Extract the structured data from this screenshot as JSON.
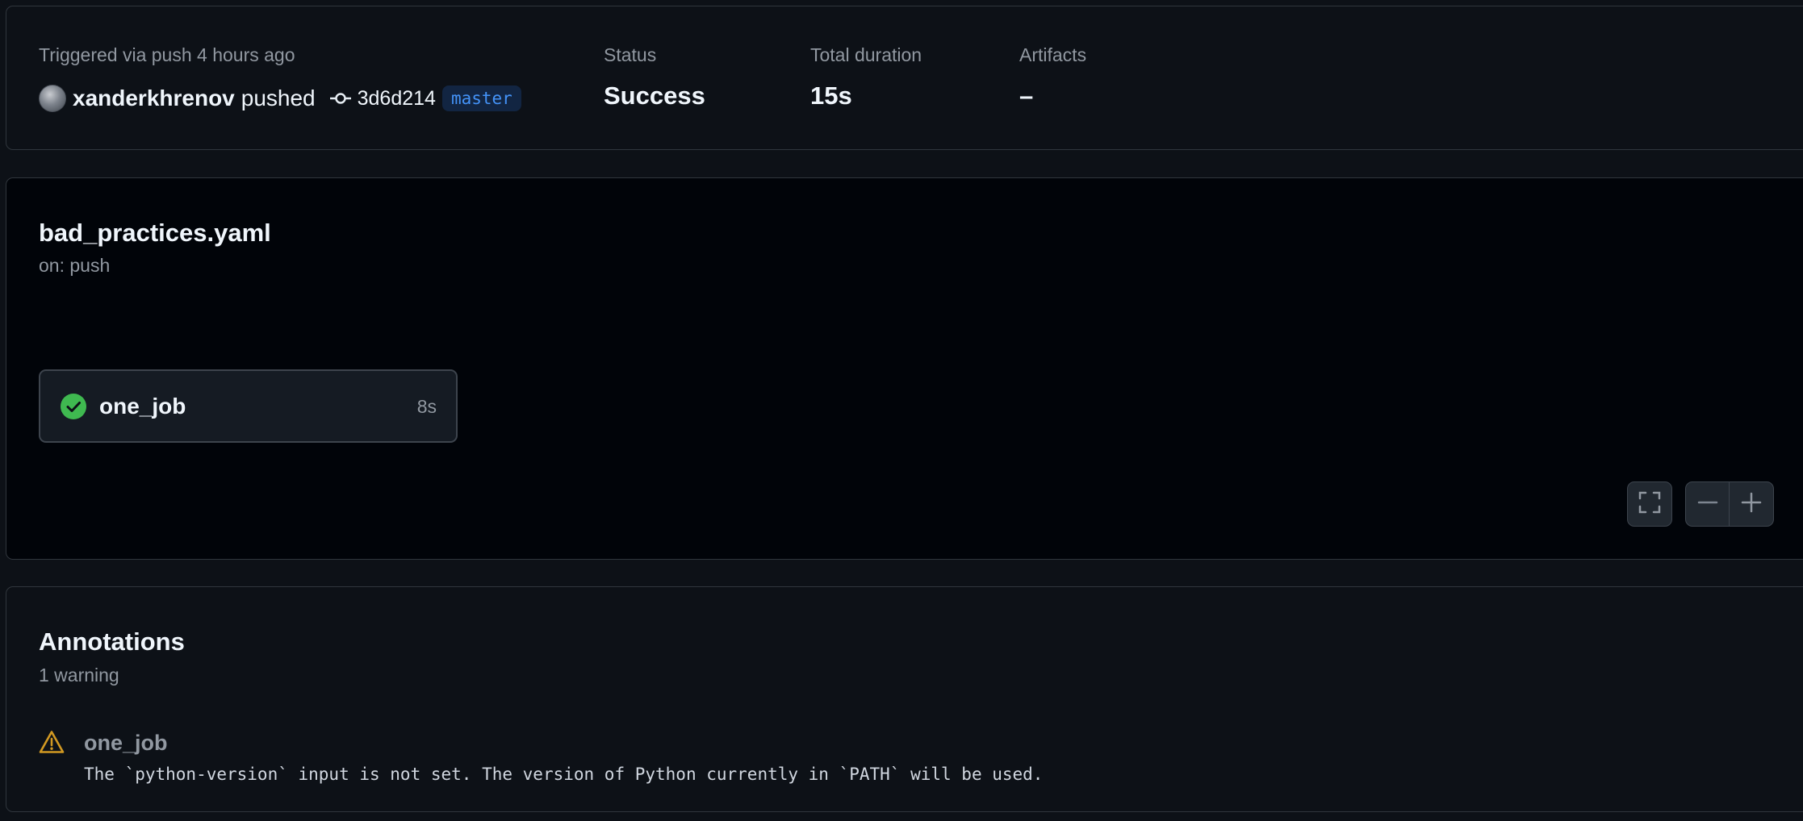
{
  "summary": {
    "trigger_text": "Triggered via push 4 hours ago",
    "pusher": "xanderkhrenov",
    "pushed_word": "pushed",
    "commit_sha": "3d6d214",
    "branch": "master",
    "status_label": "Status",
    "status_value": "Success",
    "duration_label": "Total duration",
    "duration_value": "15s",
    "artifacts_label": "Artifacts",
    "artifacts_value": "–"
  },
  "workflow": {
    "file_name": "bad_practices.yaml",
    "trigger": "on: push",
    "jobs": [
      {
        "name": "one_job",
        "duration": "8s",
        "status": "success"
      }
    ],
    "controls": {
      "fullscreen_icon": "fullscreen-icon",
      "zoom_out_icon": "minus-icon",
      "zoom_in_icon": "plus-icon"
    }
  },
  "annotations": {
    "title": "Annotations",
    "count_text": "1 warning",
    "items": [
      {
        "job": "one_job",
        "level": "warning",
        "message": "The `python-version` input is not set. The version of Python currently in `PATH` will be used."
      }
    ]
  },
  "colors": {
    "background": "#0d1117",
    "success": "#3fb950",
    "warning": "#d29922",
    "link": "#4493f8"
  }
}
